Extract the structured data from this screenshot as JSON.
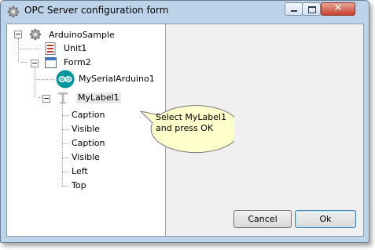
{
  "window": {
    "title": "OPC Server configuration form",
    "close_glyph": "✕"
  },
  "tree": {
    "root": "ArduinoSample",
    "unit": "Unit1",
    "form": "Form2",
    "serial": "MySerialArduino1",
    "label": "MyLabel1",
    "properties": [
      "Caption",
      "Visible",
      "Caption",
      "Visible",
      "Left",
      "Top"
    ],
    "icons": {
      "root": "gear-icon",
      "unit": "unit-icon",
      "form": "form-icon",
      "serial": "arduino-icon",
      "label": "text-label-icon"
    }
  },
  "callout": {
    "line1": "Select MyLabel1",
    "line2": "and press OK",
    "fill": "#ffffcc"
  },
  "buttons": {
    "cancel": "Cancel",
    "ok": "Ok"
  },
  "colors": {
    "frame": "#bcd3ea",
    "close_button": "#c9402c",
    "arduino": "#00979c"
  }
}
